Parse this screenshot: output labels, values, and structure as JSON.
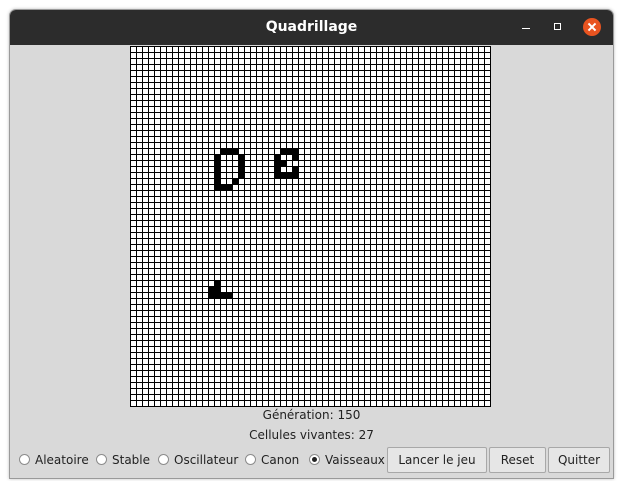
{
  "window": {
    "title": "Quadrillage"
  },
  "grid": {
    "rows": 60,
    "cols": 60,
    "line_color": "#000000",
    "cell_color": "#ffffff",
    "alive_color": "#000000",
    "alive_cells": [
      [
        17,
        15
      ],
      [
        17,
        16
      ],
      [
        17,
        17
      ],
      [
        18,
        14
      ],
      [
        18,
        18
      ],
      [
        19,
        14
      ],
      [
        19,
        18
      ],
      [
        20,
        14
      ],
      [
        20,
        18
      ],
      [
        21,
        14
      ],
      [
        21,
        18
      ],
      [
        22,
        14
      ],
      [
        22,
        17
      ],
      [
        23,
        14
      ],
      [
        23,
        15
      ],
      [
        23,
        16
      ],
      [
        17,
        25
      ],
      [
        17,
        26
      ],
      [
        17,
        27
      ],
      [
        18,
        24
      ],
      [
        18,
        27
      ],
      [
        19,
        24
      ],
      [
        19,
        25
      ],
      [
        20,
        24
      ],
      [
        20,
        27
      ],
      [
        21,
        24
      ],
      [
        21,
        25
      ],
      [
        21,
        26
      ],
      [
        21,
        27
      ],
      [
        39,
        14
      ],
      [
        40,
        13
      ],
      [
        40,
        14
      ],
      [
        41,
        13
      ],
      [
        41,
        14
      ],
      [
        41,
        15
      ],
      [
        41,
        16
      ]
    ]
  },
  "status": {
    "generation": "Génération: 150",
    "alive": "Cellules vivantes: 27"
  },
  "controls": {
    "radios": [
      {
        "label": "Aleatoire",
        "selected": false
      },
      {
        "label": "Stable",
        "selected": false
      },
      {
        "label": "Oscillateur",
        "selected": false
      },
      {
        "label": "Canon",
        "selected": false
      },
      {
        "label": "Vaisseaux",
        "selected": true
      }
    ],
    "buttons": {
      "start": "Lancer le jeu",
      "reset": "Reset",
      "quit": "Quitter"
    }
  }
}
